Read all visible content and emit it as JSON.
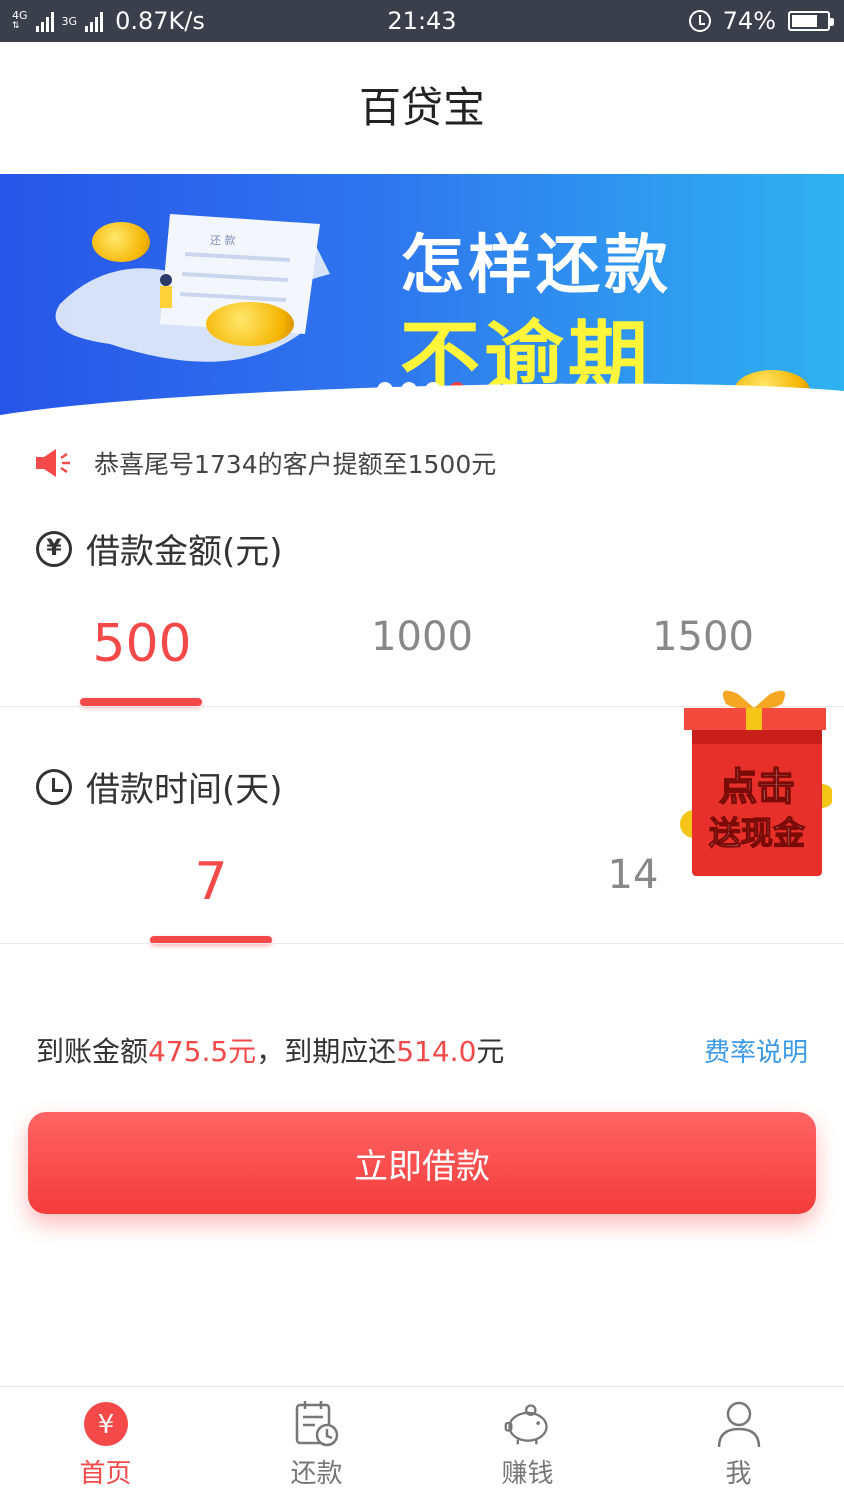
{
  "status_bar": {
    "network_1": "4G",
    "network_2": "4G",
    "network_3": "3G",
    "speed": "0.87K/s",
    "time": "21:43",
    "battery_percent": "74%",
    "battery_level": 0.74
  },
  "header": {
    "title": "百贷宝"
  },
  "banner": {
    "line1": "怎样还款",
    "line2": "不逾期",
    "paper_label": "还 款",
    "slide_count": 4,
    "active_slide": 4
  },
  "notice": {
    "text": "恭喜尾号1734的客户提额至1500元"
  },
  "amount": {
    "title": "借款金额(元)",
    "icon_symbol": "¥",
    "options": [
      "500",
      "1000",
      "1500"
    ],
    "selected": "500"
  },
  "term": {
    "title": "借款时间(天)",
    "options": [
      "7",
      "14"
    ],
    "selected": "7"
  },
  "gift": {
    "line1": "点击",
    "line2": "送现金"
  },
  "summary": {
    "received_label": "到账金额",
    "received_value": "475.5元",
    "separator": "，",
    "due_label": "到期应还",
    "due_value": "514.0",
    "due_unit": "元",
    "rate_link": "费率说明"
  },
  "borrow_button": {
    "label": "立即借款"
  },
  "tabbar": {
    "tabs": [
      {
        "label": "首页",
        "icon": "yen-circle-icon",
        "active": true
      },
      {
        "label": "还款",
        "icon": "calendar-clock-icon",
        "active": false
      },
      {
        "label": "赚钱",
        "icon": "piggy-bank-icon",
        "active": false
      },
      {
        "label": "我",
        "icon": "user-icon",
        "active": false
      }
    ]
  },
  "colors": {
    "accent_red": "#f44949",
    "link_blue": "#3d9ae8",
    "status_bar_bg": "#3a3f4b",
    "banner_yellow": "#fff53b"
  }
}
